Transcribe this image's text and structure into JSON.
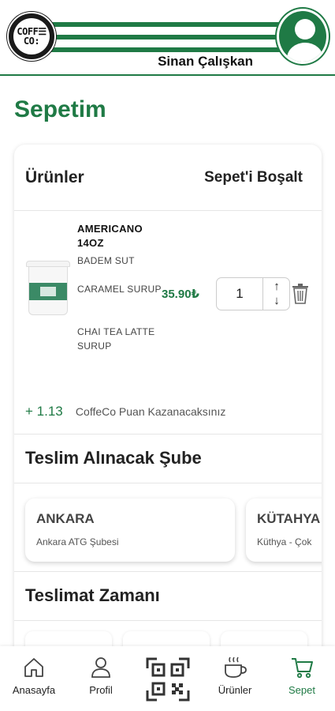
{
  "header": {
    "logo_line1": "COFF☰",
    "logo_line2": "CO:",
    "username": "Sinan Çalışkan",
    "brand_color": "#1f7a45"
  },
  "page": {
    "title": "Sepetim"
  },
  "cart": {
    "heading": "Ürünler",
    "clear_label": "Sepet'i Boşalt",
    "items": [
      {
        "name": "AMERICANO 14OZ",
        "options": [
          "BADEM SUT",
          "CARAMEL SURUP",
          "CHAI TEA LATTE SURUP"
        ],
        "price": "35.90₺",
        "quantity": "1",
        "increase_label": "↑",
        "decrease_label": "↓"
      }
    ],
    "points_value": "+ 1.13",
    "points_text": "CoffeCo Puan Kazanacaksınız"
  },
  "pickup": {
    "heading": "Teslim Alınacak Şube",
    "branches": [
      {
        "name": "ANKARA",
        "sub": "Ankara ATG Şubesi"
      },
      {
        "name": "KÜTAHYA",
        "sub": "Küthya - Çok"
      }
    ]
  },
  "delivery": {
    "heading": "Teslimat Zamanı"
  },
  "nav": {
    "items": [
      {
        "label": "Anasayfa",
        "icon": "home-icon"
      },
      {
        "label": "Profil",
        "icon": "user-icon"
      },
      {
        "label": "",
        "icon": "qr-code-icon"
      },
      {
        "label": "Ürünler",
        "icon": "coffee-cup-icon"
      },
      {
        "label": "Sepet",
        "icon": "cart-icon",
        "active": true
      }
    ]
  }
}
